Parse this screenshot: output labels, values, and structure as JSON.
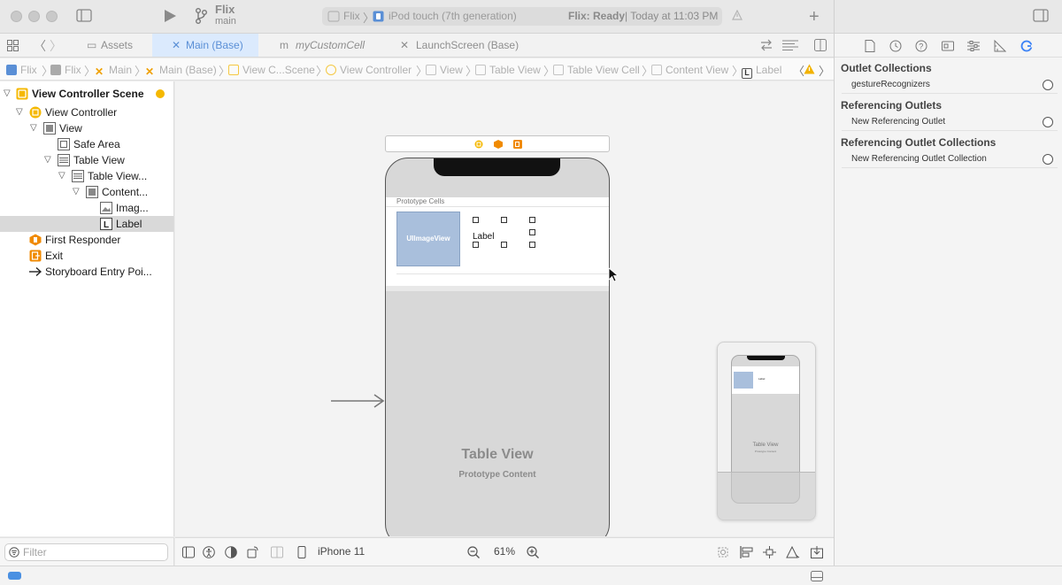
{
  "titlebar": {
    "project_name": "Flix",
    "branch": "main",
    "scheme": "Flix",
    "device": "iPod touch (7th generation)",
    "status_prefix": "Flix: Ready",
    "status_suffix": "| Today at 11:03 PM",
    "icons": [
      "close-dot",
      "minimize-dot",
      "zoom-dot",
      "sidebar-toggle-icon",
      "run-icon",
      "branch-icon",
      "warning-icon",
      "add-icon",
      "inspector-toggle-icon"
    ]
  },
  "tabs": [
    {
      "label": "Assets",
      "icon": "assets-icon",
      "active": false
    },
    {
      "label": "Main (Base)",
      "icon": "storyboard-icon",
      "active": true
    },
    {
      "label": "myCustomCell",
      "icon": "m-file-icon",
      "active": false
    },
    {
      "label": "LaunchScreen (Base)",
      "icon": "storyboard-icon",
      "active": false
    }
  ],
  "jumpbar": {
    "crumbs": [
      "Flix",
      "Flix",
      "Main",
      "Main (Base)",
      "View C...Scene",
      "View Controller",
      "View",
      "Table View",
      "Table View Cell",
      "Content View",
      "Label"
    ]
  },
  "navigator": {
    "rows": [
      {
        "label": "View Controller Scene",
        "icon": "scene-icon",
        "bold": true
      },
      {
        "label": "View Controller",
        "icon": "view-controller-icon"
      },
      {
        "label": "View",
        "icon": "view-icon"
      },
      {
        "label": "Safe Area",
        "icon": "safe-area-icon"
      },
      {
        "label": "Table View",
        "icon": "table-view-icon"
      },
      {
        "label": "Table View...",
        "icon": "table-view-cell-icon"
      },
      {
        "label": "Content...",
        "icon": "content-view-icon"
      },
      {
        "label": "Imag...",
        "icon": "image-view-icon"
      },
      {
        "label": "Label",
        "icon": "label-icon",
        "selected": true
      },
      {
        "label": "First Responder",
        "icon": "first-responder-icon"
      },
      {
        "label": "Exit",
        "icon": "exit-icon"
      },
      {
        "label": "Storyboard Entry Poi...",
        "icon": "entry-arrow-icon"
      }
    ],
    "filter_placeholder": "Filter"
  },
  "canvas": {
    "prototype_header": "Prototype Cells",
    "image_view_text": "UIImageView",
    "cell_label": "Label",
    "table_view_title": "Table View",
    "table_view_subtitle": "Prototype Content",
    "minimap_label_text": "Label",
    "minimap_tv_title": "Table View",
    "minimap_tv_subtitle": "Prototype Content"
  },
  "canvas_bar": {
    "device": "iPhone 11",
    "zoom": "61%"
  },
  "inspector": {
    "sections": [
      {
        "heading": "Outlet Collections",
        "rows": [
          "gestureRecognizers"
        ]
      },
      {
        "heading": "Referencing Outlets",
        "rows": [
          "New Referencing Outlet"
        ]
      },
      {
        "heading": "Referencing Outlet Collections",
        "rows": [
          "New Referencing Outlet Collection"
        ]
      }
    ],
    "active_tab_color": "#3b82f6"
  },
  "colors": {
    "accent": "#3b82f6",
    "selection": "#d9d9d9",
    "scene_yellow": "#f5b800",
    "responder_orange": "#f08a00",
    "image_view_blue": "#a9bfdc"
  }
}
